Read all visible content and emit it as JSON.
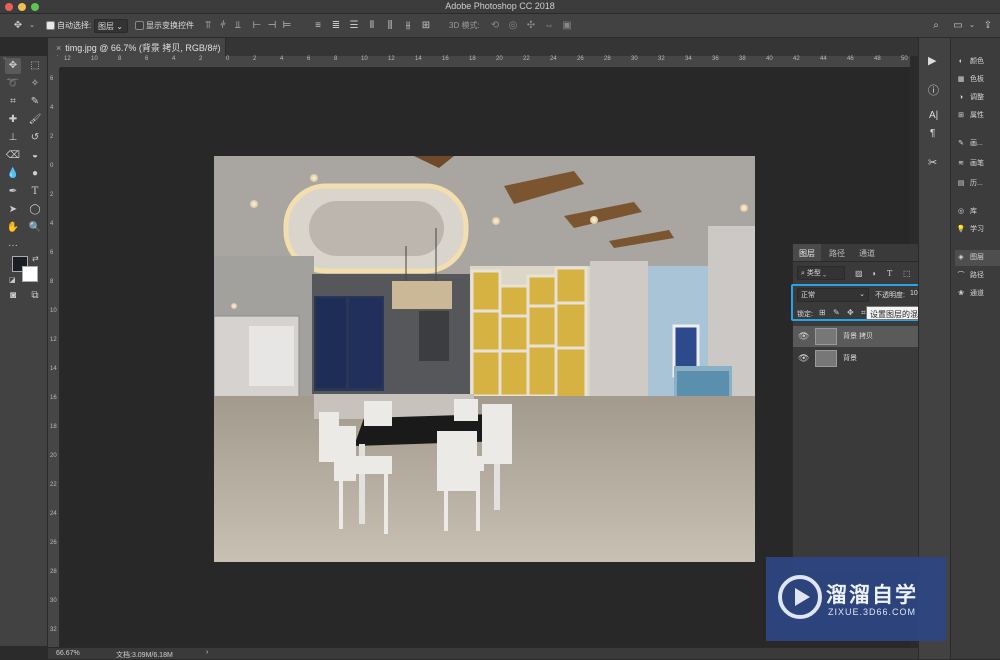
{
  "window": {
    "title": "Adobe Photoshop CC 2018"
  },
  "options_bar": {
    "auto_select_label": "自动选择:",
    "auto_select_value": "图层",
    "show_transform_label": "显示变换控件",
    "mode_3d_label": "3D 模式:"
  },
  "document": {
    "tab_title": "timg.jpg @ 66.7% (背景 拷贝, RGB/8#) *"
  },
  "ruler_h": [
    "12",
    "10",
    "8",
    "6",
    "4",
    "2",
    "0",
    "2",
    "4",
    "6",
    "8",
    "10",
    "12",
    "14",
    "16",
    "18",
    "20",
    "22",
    "24",
    "26",
    "28",
    "30",
    "32",
    "34",
    "36",
    "38",
    "40",
    "42",
    "44",
    "46",
    "48",
    "50"
  ],
  "ruler_v": [
    "6",
    "4",
    "2",
    "0",
    "2",
    "4",
    "6",
    "8",
    "10",
    "12",
    "14",
    "16",
    "18",
    "20",
    "22",
    "24",
    "26",
    "28",
    "30",
    "32"
  ],
  "status": {
    "zoom": "66.67%",
    "doc_info": "文档:3.09M/6.18M"
  },
  "dock": {
    "items": [
      {
        "icon": "palette-icon",
        "label": "颜色"
      },
      {
        "icon": "swatches-icon",
        "label": "色板"
      },
      {
        "icon": "adjustments-icon",
        "label": "调整"
      },
      {
        "icon": "properties-icon",
        "label": "属性"
      },
      {
        "icon": "brush-icon",
        "label": "画..."
      },
      {
        "icon": "brush-settings-icon",
        "label": "画笔"
      },
      {
        "icon": "history-icon",
        "label": "历..."
      },
      {
        "icon": "library-icon",
        "label": "库"
      },
      {
        "icon": "bulb-icon",
        "label": "学习"
      },
      {
        "icon": "layers-icon",
        "label": "图层"
      },
      {
        "icon": "paths-icon",
        "label": "路径"
      },
      {
        "icon": "channels-icon",
        "label": "通道"
      }
    ]
  },
  "layers_panel": {
    "tabs": [
      "图层",
      "路径",
      "通道"
    ],
    "filter_label": "类型",
    "blend_mode": "正常",
    "opacity_label": "不透明度:",
    "opacity_value": "100%",
    "lock_label": "锁定:",
    "tooltip": "设置图层的混合模式",
    "layers": [
      {
        "name": "背景 拷贝",
        "visible": true,
        "locked": false,
        "selected": true
      },
      {
        "name": "背景",
        "visible": true,
        "locked": true,
        "selected": false
      }
    ]
  },
  "watermark": {
    "brand": "溜溜自学",
    "url": "ZIXUE.3D66.COM"
  },
  "colors": {
    "accent_highlight": "#2aa2e8",
    "foreground": "#1b1f24",
    "background": "#ffffff"
  }
}
